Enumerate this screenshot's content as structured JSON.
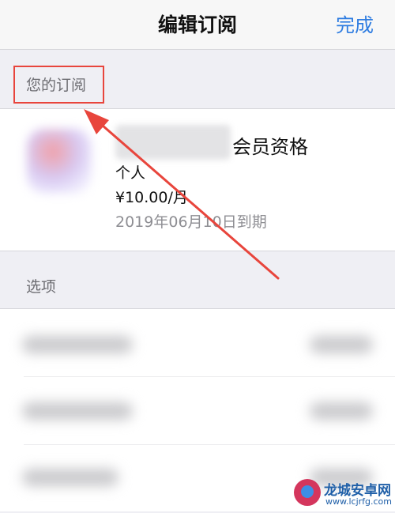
{
  "navbar": {
    "title": "编辑订阅",
    "done_label": "完成"
  },
  "subscriptions_section": {
    "header": "您的订阅",
    "item": {
      "name_suffix": "会员资格",
      "plan": "个人",
      "price": "¥10.00/月",
      "expiry": "2019年06月10日到期"
    }
  },
  "options_section": {
    "header": "选项"
  },
  "watermark": {
    "name": "龙城安卓网",
    "url": "www.lcjrfg.com"
  },
  "colors": {
    "accent": "#2f7de1",
    "annotation": "#e8453c"
  }
}
